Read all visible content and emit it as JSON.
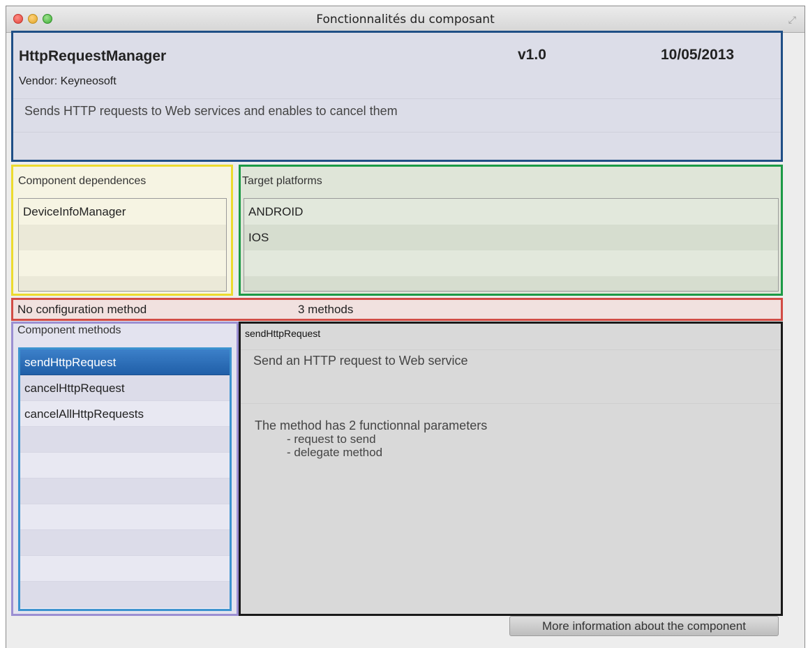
{
  "window": {
    "title": "Fonctionnalités du composant",
    "resize_icon": "resize-icon"
  },
  "header": {
    "component_name": "HttpRequestManager",
    "version": "v1.0",
    "date": "10/05/2013",
    "vendor": "Vendor: Keyneosoft",
    "description": "Sends HTTP requests to Web services and enables to cancel them"
  },
  "dependences": {
    "label": "Component dependences",
    "items": [
      "DeviceInfoManager",
      "",
      "",
      ""
    ]
  },
  "platforms": {
    "label": "Target platforms",
    "items": [
      "ANDROID",
      "IOS",
      "",
      ""
    ]
  },
  "config": {
    "configuration": "No configuration method",
    "methods_count": "3 methods"
  },
  "methods": {
    "label": "Component methods",
    "selected_index": 0,
    "items": [
      "sendHttpRequest",
      "cancelHttpRequest",
      "cancelAllHttpRequests",
      "",
      "",
      "",
      "",
      "",
      "",
      ""
    ]
  },
  "detail": {
    "method_name": "sendHttpRequest",
    "description": "Send an HTTP request to Web service",
    "params_intro": "The method has 2 functionnal parameters",
    "params": [
      "- request to send",
      "- delegate method"
    ]
  },
  "footer": {
    "more_info_label": "More information about the component"
  },
  "colors": {
    "header_border": "#1f4f86",
    "dependences_border": "#ecdb2f",
    "platforms_border": "#1c9a46",
    "config_border": "#d24c45",
    "methods_border": "#9b8fd2",
    "methods_list_border": "#3c93cf",
    "detail_border": "#1a1a1a",
    "selection": "#2f6fbb"
  }
}
